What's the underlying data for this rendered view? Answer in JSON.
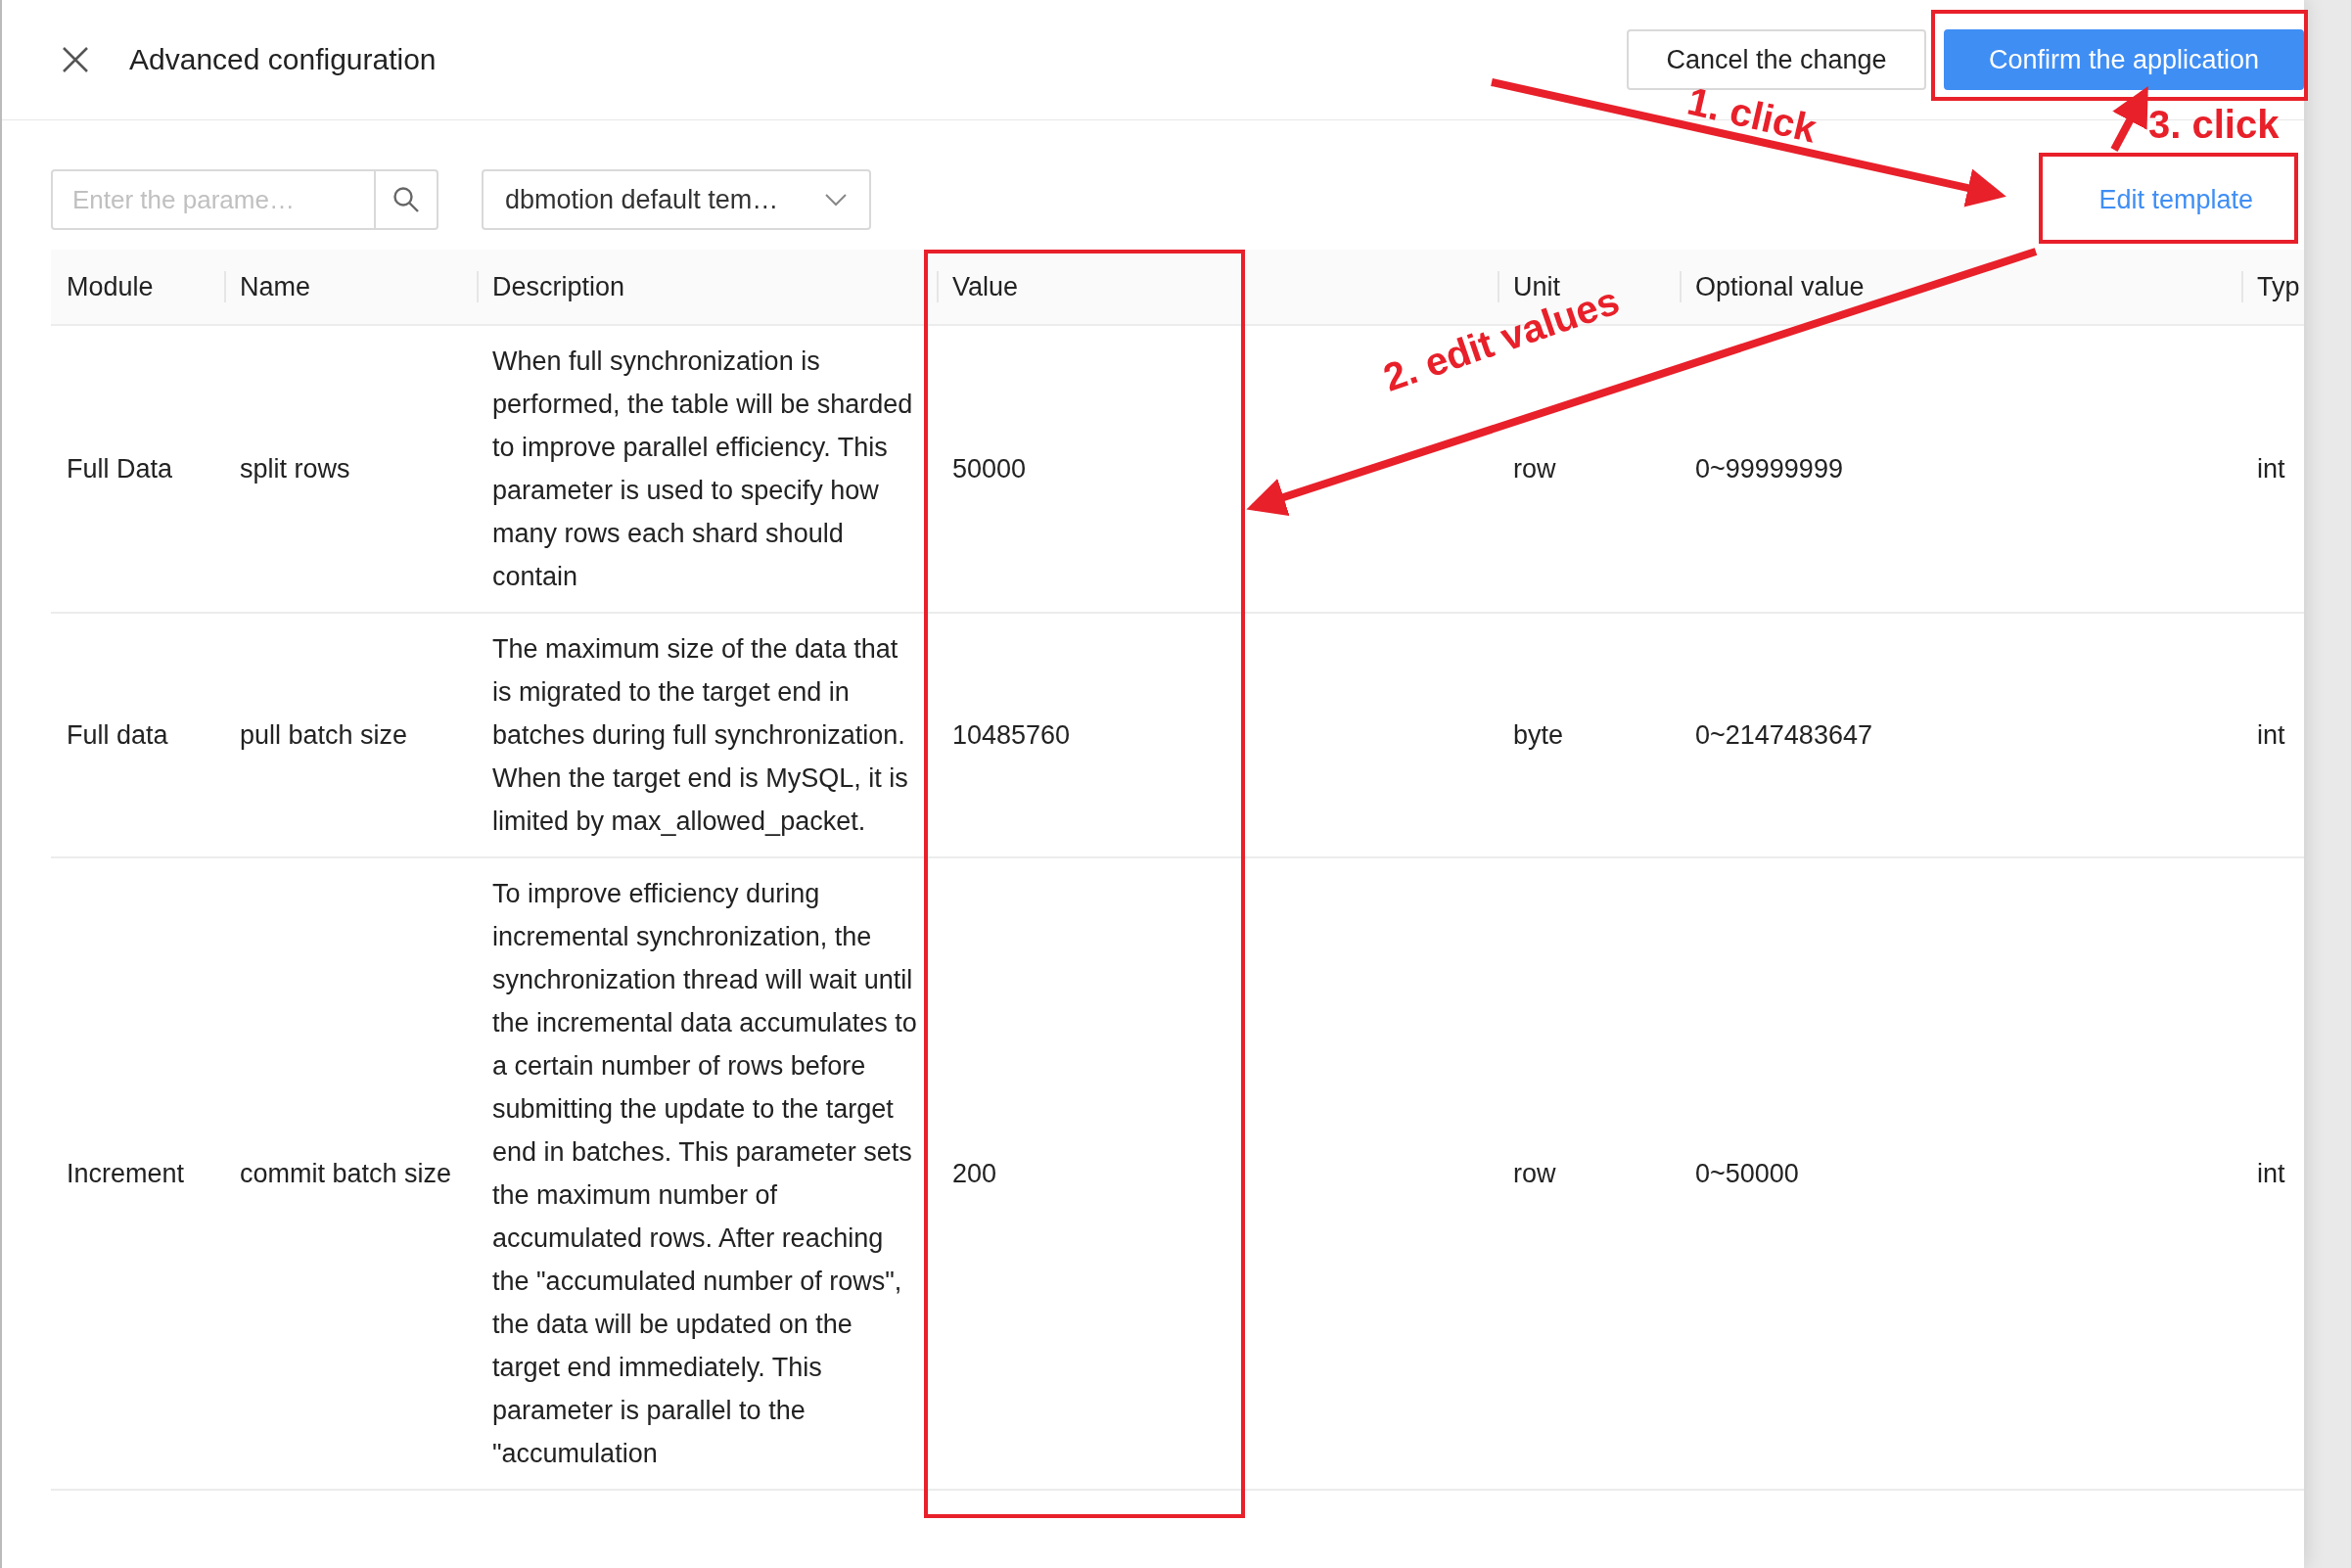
{
  "window": {
    "title": "Advanced configuration"
  },
  "buttons": [
    {
      "label": "Cancel the change",
      "kind": "secondary"
    },
    {
      "label": "Confirm the application",
      "kind": "primary"
    }
  ],
  "search": {
    "placeholder": "Enter the parame…"
  },
  "template_select": {
    "value": "dbmotion default tem…"
  },
  "edit_template_link": "Edit template",
  "table": {
    "columns": [
      "Module",
      "Name",
      "Description",
      "Value",
      "Unit",
      "Optional value",
      "Typ"
    ],
    "rows": [
      {
        "cells": [
          "Full Data",
          "split rows",
          "When full synchronization is performed, the table will be sharded to improve parallel efficiency. This parameter is used to specify how many rows each shard should contain",
          "50000",
          "row",
          "0~99999999",
          "int"
        ]
      },
      {
        "cells": [
          "Full data",
          "pull batch size",
          "The maximum size of the data that is migrated to the target end in batches during full synchronization. When the target end is MySQL, it is limited by max_allowed_packet.",
          "10485760",
          "byte",
          "0~2147483647",
          "int"
        ]
      },
      {
        "cells": [
          "Increment",
          "commit batch size",
          "To improve efficiency during incremental synchronization, the synchronization thread will wait until the incremental data accumulates to a certain number of rows before submitting the update to the target end in batches. This parameter sets the maximum number of accumulated rows. After reaching the \"accumulated number of rows\", the data will be updated on the target end immediately. This parameter is parallel to the \"accumulation",
          "200",
          "row",
          "0~50000",
          "int"
        ]
      }
    ]
  },
  "annotations": [
    {
      "kind": "arrow",
      "label": "1. click"
    },
    {
      "kind": "arrow",
      "label": "2. edit values"
    },
    {
      "kind": "arrow",
      "label": "3. click"
    },
    {
      "kind": "box"
    },
    {
      "kind": "box"
    },
    {
      "kind": "box"
    }
  ]
}
